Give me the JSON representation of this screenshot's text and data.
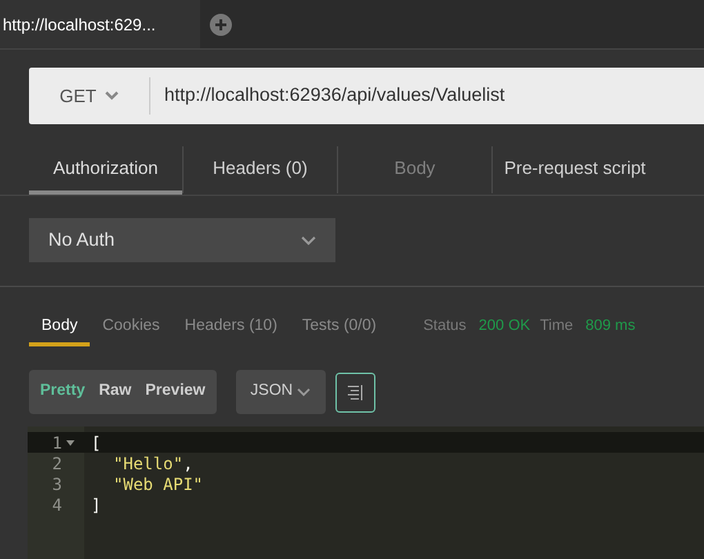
{
  "tabs": [
    {
      "label": "http://localhost:629...",
      "selected": true
    }
  ],
  "request": {
    "method": "GET",
    "url": "http://localhost:62936/api/values/Valuelist"
  },
  "request_tabs": [
    {
      "label": "Authorization",
      "selected": true,
      "disabled": false
    },
    {
      "label": "Headers (0)",
      "selected": false,
      "disabled": false
    },
    {
      "label": "Body",
      "selected": false,
      "disabled": true
    },
    {
      "label": "Pre-request script",
      "selected": false,
      "disabled": false
    }
  ],
  "auth": {
    "value": "No Auth"
  },
  "response_tabs": [
    {
      "label": "Body",
      "selected": true
    },
    {
      "label": "Cookies",
      "selected": false
    },
    {
      "label": "Headers (10)",
      "selected": false
    },
    {
      "label": "Tests (0/0)",
      "selected": false
    }
  ],
  "status": {
    "status_label": "Status",
    "status_value": "200 OK",
    "time_label": "Time",
    "time_value": "809 ms"
  },
  "view_modes": [
    {
      "label": "Pretty",
      "selected": true
    },
    {
      "label": "Raw",
      "selected": false
    },
    {
      "label": "Preview",
      "selected": false
    }
  ],
  "format": {
    "value": "JSON"
  },
  "code_lines": [
    {
      "number": "1",
      "foldable": true,
      "active": true,
      "tokens": [
        {
          "text": "[",
          "kind": "punct"
        }
      ],
      "children": [
        {
          "number": "2",
          "foldable": false,
          "active": false,
          "tokens": [
            {
              "text": "\"Hello\"",
              "kind": "string"
            },
            {
              "text": ",",
              "kind": "punct"
            }
          ]
        },
        {
          "number": "3",
          "foldable": false,
          "active": false,
          "tokens": [
            {
              "text": "\"Web API\"",
              "kind": "string"
            }
          ]
        }
      ]
    },
    {
      "number": "4",
      "foldable": false,
      "active": false,
      "tokens": [
        {
          "text": "]",
          "kind": "punct"
        }
      ]
    }
  ]
}
